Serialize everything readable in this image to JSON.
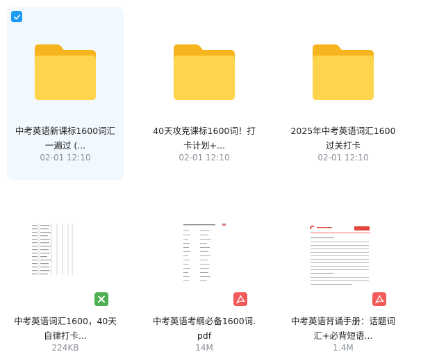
{
  "files": [
    {
      "name_line1": "中考英语新课标1600词汇",
      "name_line2": "一遍过 (...",
      "meta": "02-01 12:10",
      "kind": "folder",
      "selected": true,
      "icon": "folder-icon"
    },
    {
      "name_line1": "40天攻克课标1600词！打",
      "name_line2": "卡计划+...",
      "meta": "02-01 12:10",
      "kind": "folder",
      "selected": false,
      "icon": "folder-icon"
    },
    {
      "name_line1": "2025年中考英语词汇1600",
      "name_line2": "过关打卡",
      "meta": "02-01 12:10",
      "kind": "folder",
      "selected": false,
      "icon": "folder-icon"
    },
    {
      "name_line1": "中考英语词汇1600，40天",
      "name_line2": "自律打卡...",
      "meta": "224KB",
      "kind": "excel",
      "icon": "excel-icon"
    },
    {
      "name_line1": "中考英语考纲必备1600词.",
      "name_line2": "pdf",
      "meta": "14M",
      "kind": "pdf",
      "icon": "pdf-icon"
    },
    {
      "name_line1": "中考英语背诵手册：话题词",
      "name_line2": "汇+必背短语...",
      "meta": "1.4M",
      "kind": "pdf",
      "icon": "pdf-icon"
    }
  ],
  "colors": {
    "selection_bg": "#f1f8fe",
    "checkbox": "#1d9bf0",
    "folder_back": "#f6b51e",
    "folder_front": "#ffd44d",
    "excel_badge": "#4caf50",
    "pdf_badge": "#f25a5a"
  }
}
